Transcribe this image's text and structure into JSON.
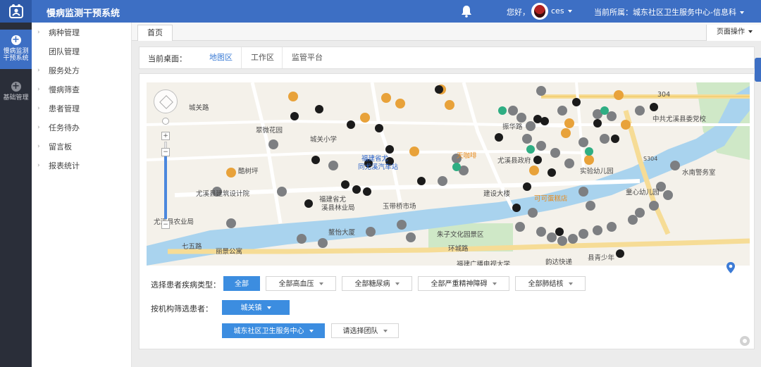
{
  "app": {
    "title": "慢病监测干预系统",
    "greeting": "您好，",
    "username": "ces",
    "org_label": "当前所属：城东社区卫生服务中心-信息科"
  },
  "rail": [
    {
      "label_line1": "慢病监测",
      "label_line2": "干预系统",
      "icon": "plus-circle-icon"
    },
    {
      "label_line1": "基础管理",
      "label_line2": "",
      "icon": "plus-circle-icon"
    }
  ],
  "sidebar": {
    "items": [
      {
        "label": "病种管理"
      },
      {
        "label": "团队管理"
      },
      {
        "label": "服务处方"
      },
      {
        "label": "慢病筛查"
      },
      {
        "label": "患者管理"
      },
      {
        "label": "任务待办"
      },
      {
        "label": "留言板"
      },
      {
        "label": "报表统计"
      }
    ]
  },
  "tabs": {
    "home": "首页",
    "page_ops": "页面操作"
  },
  "desk": {
    "label": "当前桌面：",
    "tabs": [
      "地图区",
      "工作区",
      "监管平台"
    ]
  },
  "map": {
    "places": [
      "翠微花园",
      "城关小学",
      "酷树坪",
      "尤溪县建筑设计院",
      "尤溪县农业局",
      "福建省尤",
      "溪县林业局",
      "玉带桥市场",
      "建设大楼",
      "可可蛋糕店",
      "尤溪县政府",
      "实验幼儿园",
      "水南警务室",
      "童心幼儿园",
      "中共尤溪县委党校",
      "朱子文化园景区",
      "环城路",
      "韵达快递",
      "福建广播电视大学",
      "县青少年",
      "鳌怡大厦",
      "丽景公寓",
      "七五路",
      "304",
      "S304",
      "天咖啡",
      "同尤溪汽车站",
      "福建省尤",
      "振华路",
      "城关路"
    ]
  },
  "filters": {
    "disease_label": "选择患者疾病类型：",
    "disease_buttons": [
      "全部",
      "全部高血压",
      "全部糖尿病",
      "全部严重精神障碍",
      "全部肺结核"
    ],
    "org_label": "按机构筛选患者：",
    "town": "城关镇",
    "center": "城东社区卫生服务中心",
    "team_placeholder": "请选择团队"
  },
  "colors": {
    "topbar": "#3d6fc4",
    "rail": "#2a2e39",
    "accent": "#3c8de0",
    "marker_orange": "#e8a23a",
    "marker_gray": "#7d7f82",
    "marker_black": "#1b1b1b",
    "marker_green": "#2fae83",
    "river": "#a9d3ee",
    "park": "#cfe8c7"
  },
  "icons": {
    "logo": "people-network-icon",
    "bell": "bell-icon",
    "map_markers": [
      "heart-pulse-marker-icon",
      "black-pin-marker-icon",
      "cross-marker-icon",
      "leaf-marker-icon"
    ],
    "map_zoom": [
      "pan-control-icon",
      "zoom-in-icon",
      "zoom-out-icon"
    ],
    "location": "location-pin-icon",
    "settings": "gear-icon"
  }
}
